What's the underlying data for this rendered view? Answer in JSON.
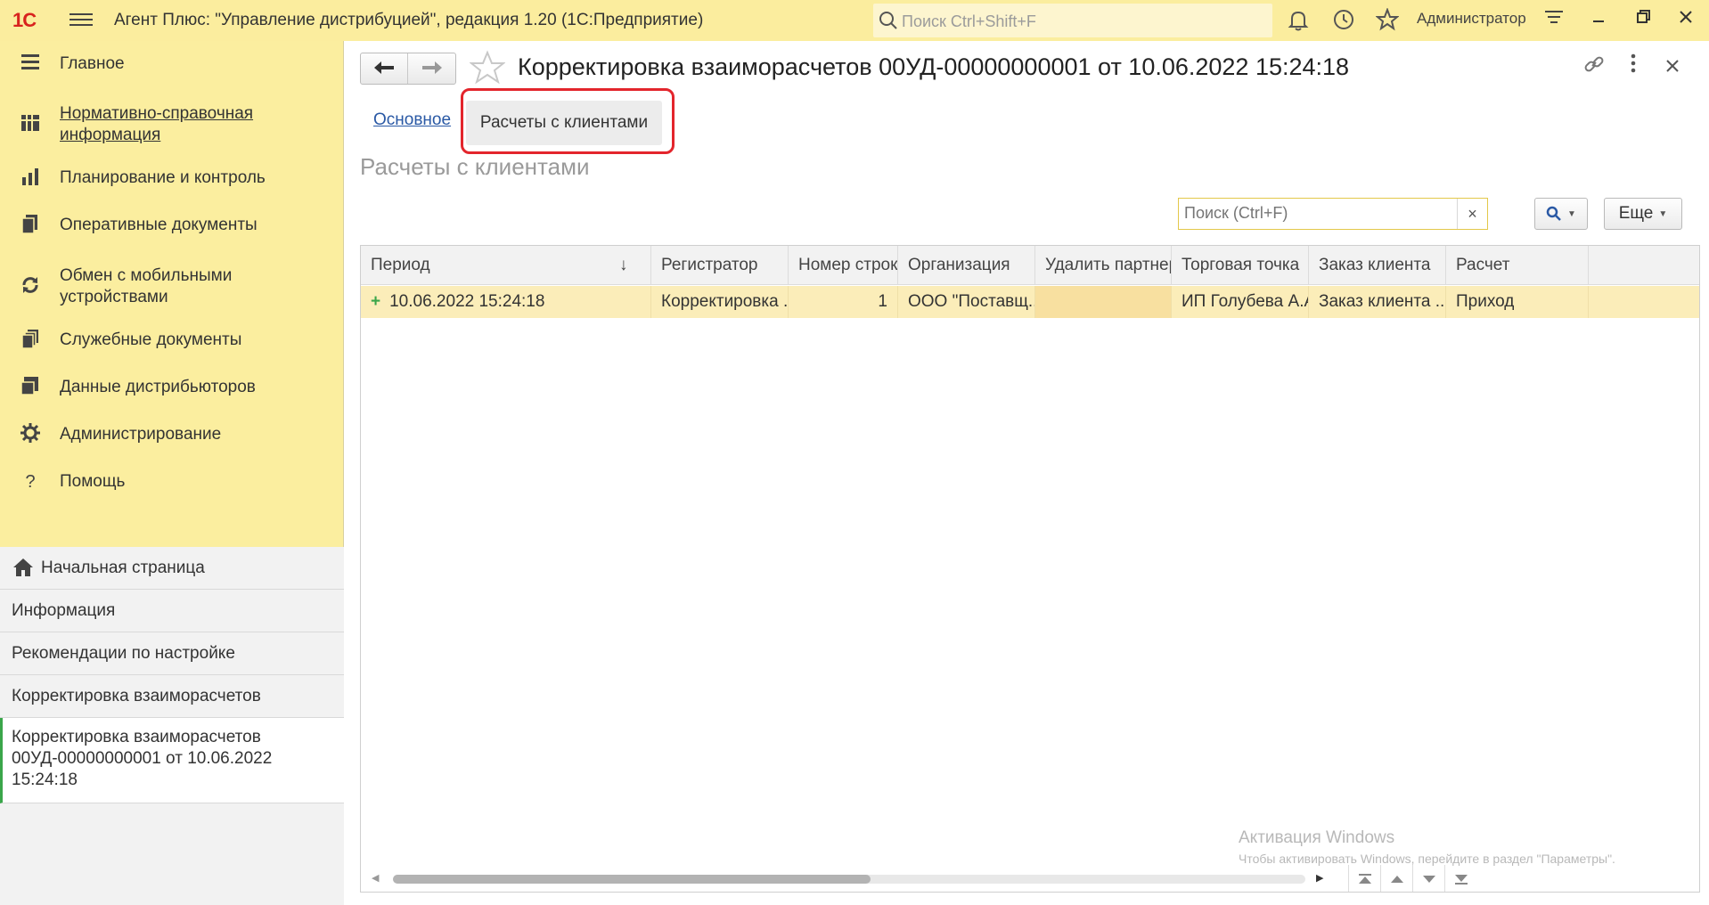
{
  "app": {
    "logo": "1С",
    "title": "Агент Плюс: \"Управление дистрибуцией\", редакция 1.20  (1С:Предприятие)",
    "search_placeholder": "Поиск Ctrl+Shift+F",
    "user": "Администратор"
  },
  "sidebar": {
    "items": [
      {
        "label": "Главное",
        "icon": "hamburger-icon"
      },
      {
        "label": "Нормативно-справочная информация",
        "icon": "grid-icon"
      },
      {
        "label": "Планирование и контроль",
        "icon": "bar-chart-icon"
      },
      {
        "label": "Оперативные документы",
        "icon": "documents-icon"
      },
      {
        "label": "Обмен с мобильными устройствами",
        "icon": "sync-icon"
      },
      {
        "label": "Служебные документы",
        "icon": "stack-icon"
      },
      {
        "label": "Данные дистрибьюторов",
        "icon": "data-icon"
      },
      {
        "label": "Администрирование",
        "icon": "gear-icon"
      },
      {
        "label": "Помощь",
        "icon": "help-icon"
      }
    ],
    "open_windows": [
      {
        "label": "Начальная страница"
      },
      {
        "label": "Информация"
      },
      {
        "label": "Рекомендации по настройке"
      },
      {
        "label": "Корректировка взаиморасчетов"
      },
      {
        "label": "Корректировка взаиморасчетов 00УД-00000000001 от 10.06.2022 15:24:18"
      }
    ]
  },
  "document": {
    "title": "Корректировка взаиморасчетов 00УД-00000000001 от 10.06.2022 15:24:18",
    "tabs": [
      {
        "label": "Основное"
      },
      {
        "label": "Расчеты с клиентами"
      }
    ],
    "section_title": "Расчеты с клиентами",
    "search_placeholder": "Поиск (Ctrl+F)",
    "more_button": "Еще"
  },
  "table": {
    "columns": [
      "Период",
      "Регистратор",
      "Номер строки",
      "Организация",
      "Удалить партнер",
      "Торговая точка",
      "Заказ клиента",
      "Расчет"
    ],
    "sort_indicator": "↓",
    "rows": [
      [
        "10.06.2022 15:24:18",
        "Корректировка ...",
        "1",
        "ООО \"Поставщ...",
        "",
        "ИП Голубева А.А.",
        "Заказ клиента ...",
        "Приход"
      ]
    ]
  },
  "watermark": {
    "line1": "Активация Windows",
    "line2": "Чтобы активировать Windows, перейдите в раздел \"Параметры\"."
  },
  "colors": {
    "titlebar": "#fbed9e",
    "sidebar": "#fbee9f",
    "selected_row": "#fbedb9",
    "highlight_frame": "#e3252c",
    "link": "#2a59a5"
  }
}
